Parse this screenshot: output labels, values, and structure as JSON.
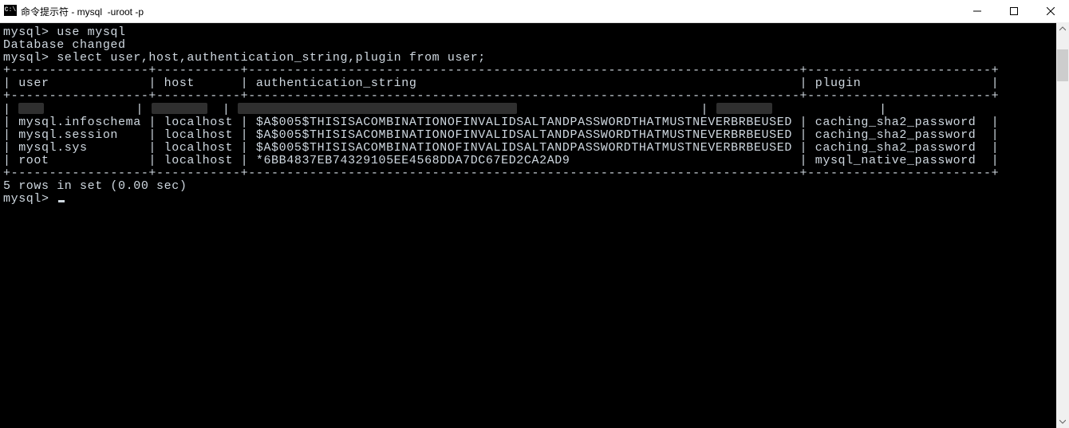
{
  "window": {
    "icon_label": "C:\\",
    "title": "命令提示符 - mysql  -uroot -p"
  },
  "prompt": "mysql> ",
  "cmd1": "use mysql",
  "resp1": "Database changed",
  "cmd2": "select user,host,authentication_string,plugin from user;",
  "table": {
    "border": "+------------------+-----------+------------------------------------------------------------------------+------------------------+",
    "headers": {
      "c1": "user",
      "c2": "host",
      "c3": "authentication_string",
      "c4": "plugin"
    },
    "rows": [
      {
        "c1": "mysql.infoschema",
        "c2": "localhost",
        "c3": "$A$005$THISISACOMBINATIONOFINVALIDSALTANDPASSWORDTHATMUSTNEVERBRBEUSED",
        "c4": "caching_sha2_password"
      },
      {
        "c1": "mysql.session",
        "c2": "localhost",
        "c3": "$A$005$THISISACOMBINATIONOFINVALIDSALTANDPASSWORDTHATMUSTNEVERBRBEUSED",
        "c4": "caching_sha2_password"
      },
      {
        "c1": "mysql.sys",
        "c2": "localhost",
        "c3": "$A$005$THISISACOMBINATIONOFINVALIDSALTANDPASSWORDTHATMUSTNEVERBRBEUSED",
        "c4": "caching_sha2_password"
      },
      {
        "c1": "root",
        "c2": "localhost",
        "c3": "*6BB4837EB74329105EE4568DDA7DC67ED2CA2AD9",
        "c4": "mysql_native_password"
      }
    ]
  },
  "summary": "5 rows in set (0.00 sec)",
  "col_widths": {
    "c1": 16,
    "c2": 9,
    "c3": 70,
    "c4": 22
  },
  "redacted_row": true
}
